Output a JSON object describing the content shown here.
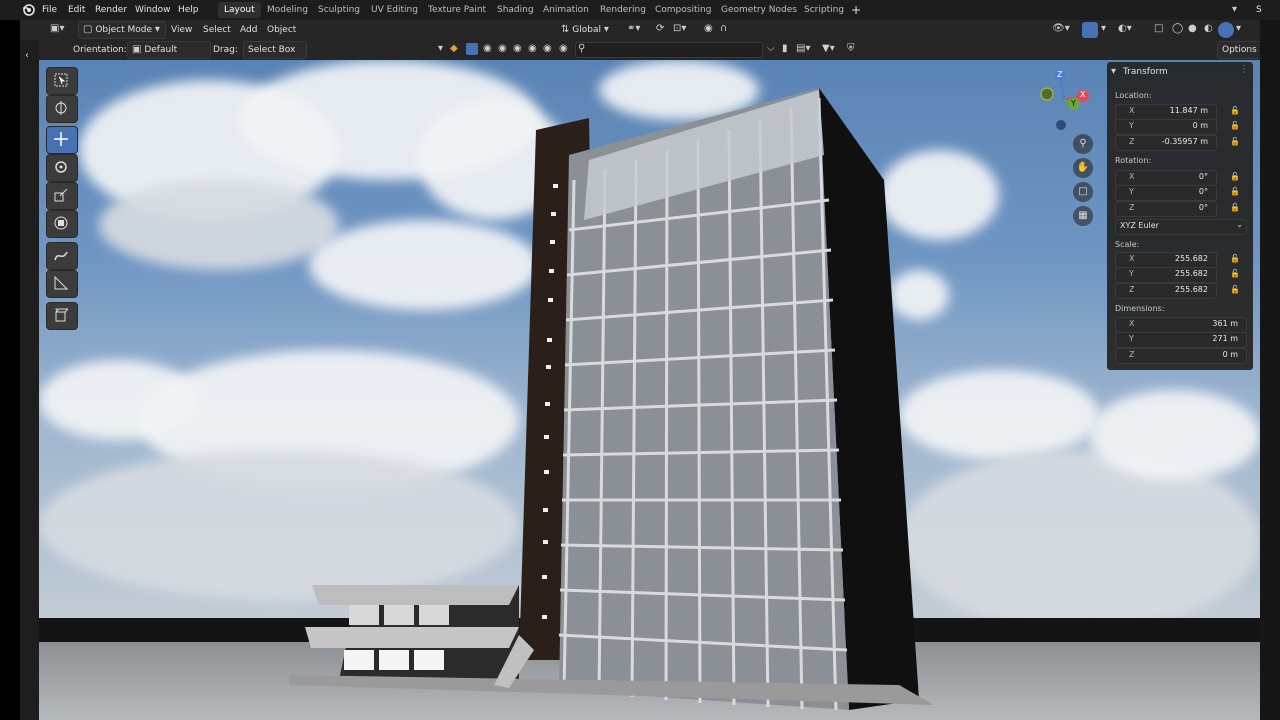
{
  "topbar": {
    "menus": [
      "File",
      "Edit",
      "Render",
      "Window",
      "Help"
    ],
    "workspaces": [
      "Layout",
      "Modeling",
      "Sculpting",
      "UV Editing",
      "Texture Paint",
      "Shading",
      "Animation",
      "Rendering",
      "Compositing",
      "Geometry Nodes",
      "Scripting"
    ],
    "active_workspace": "Layout",
    "add_tab": "+",
    "scene_label": "S"
  },
  "header": {
    "mode": "Object Mode",
    "menus": [
      "View",
      "Select",
      "Add",
      "Object"
    ],
    "transform_orientation": "Global"
  },
  "tool_header": {
    "orientation_label": "Orientation:",
    "orientation_value": "Default",
    "drag_label": "Drag:",
    "drag_value": "Select Box",
    "options_label": "Options"
  },
  "transform_panel": {
    "title": "Transform",
    "location_label": "Location:",
    "location": [
      {
        "axis": "X",
        "value": "11.847 m"
      },
      {
        "axis": "Y",
        "value": "0 m"
      },
      {
        "axis": "Z",
        "value": "-0.35957 m"
      }
    ],
    "rotation_label": "Rotation:",
    "rotation": [
      {
        "axis": "X",
        "value": "0°"
      },
      {
        "axis": "Y",
        "value": "0°"
      },
      {
        "axis": "Z",
        "value": "0°"
      }
    ],
    "rotation_mode": "XYZ Euler",
    "scale_label": "Scale:",
    "scale": [
      {
        "axis": "X",
        "value": "255.682"
      },
      {
        "axis": "Y",
        "value": "255.682"
      },
      {
        "axis": "Z",
        "value": "255.682"
      }
    ],
    "dimensions_label": "Dimensions:",
    "dimensions": [
      {
        "axis": "X",
        "value": "361 m"
      },
      {
        "axis": "Y",
        "value": "271 m"
      },
      {
        "axis": "Z",
        "value": "0 m"
      }
    ]
  },
  "gizmo": {
    "x": "X",
    "y": "Y",
    "z": "Z"
  },
  "colors": {
    "accent": "#4772b3",
    "header_bg": "#262626",
    "panel_bg": "#262626"
  }
}
